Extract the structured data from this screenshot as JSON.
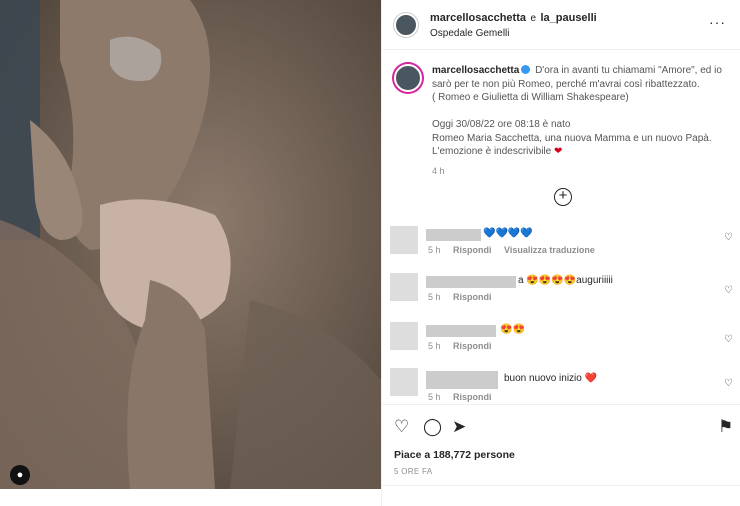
{
  "post": {
    "author": "marcellosacchetta",
    "joiner": "e",
    "coauthor": "la_pauselli",
    "location": "Ospedale Gemelli",
    "more_icon": "···",
    "caption_line1": "D'ora in avanti tu chiamami \"Amore\", ed io sarò per te non più Romeo, perché m'avrai così ribattezzato.",
    "caption_line2": "( Romeo e Giulietta di William Shakespeare)",
    "caption_line3": "Oggi 30/08/22 ore 08:18 è nato",
    "caption_line4": "Romeo Maria Sacchetta, una nuova Mamma e un nuovo Papà.",
    "caption_line5": "L'emozione è indescrivibile",
    "caption_time": "4 h",
    "load_more": "+"
  },
  "comments": [
    {
      "text": "💙💙💙💙",
      "time": "5 h",
      "reply": "Rispondi",
      "extra": "Visualizza traduzione"
    },
    {
      "text": "a 😍😍😍😍auguriiiii",
      "time": "5 h",
      "reply": "Rispondi",
      "extra": ""
    },
    {
      "text": "😍😍",
      "time": "5 h",
      "reply": "Rispondi",
      "extra": ""
    },
    {
      "text": "buon nuovo inizio ❤️",
      "time": "5 h",
      "reply": "Rispondi",
      "extra": ""
    }
  ],
  "likes": "Piace a 188,772 persone",
  "posted_ago": "5 ORE FA",
  "icons": {
    "heart": "heart-icon",
    "comment": "comment-icon",
    "share": "share-icon",
    "save": "bookmark-icon",
    "tagged": "person-icon"
  }
}
